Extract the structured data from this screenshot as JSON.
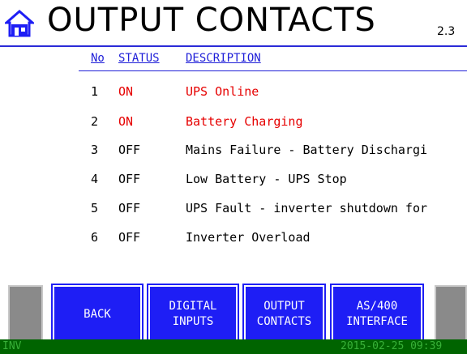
{
  "header": {
    "title": "OUTPUT CONTACTS",
    "version": "2.3",
    "home_icon": "home-icon"
  },
  "table": {
    "col_no": "No",
    "col_status": "STATUS",
    "col_description": "DESCRIPTION",
    "rows": [
      {
        "no": "1",
        "status": "ON",
        "description": "UPS Online"
      },
      {
        "no": "2",
        "status": "ON",
        "description": "Battery Charging"
      },
      {
        "no": "3",
        "status": "OFF",
        "description": "Mains Failure - Battery Dischargi"
      },
      {
        "no": "4",
        "status": "OFF",
        "description": "Low Battery - UPS Stop"
      },
      {
        "no": "5",
        "status": "OFF",
        "description": "UPS Fault - inverter shutdown for"
      },
      {
        "no": "6",
        "status": "OFF",
        "description": "Inverter Overload"
      }
    ]
  },
  "nav": {
    "back": "BACK",
    "digital_inputs_1": "DIGITAL",
    "digital_inputs_2": "INPUTS",
    "output_contacts_1": "OUTPUT",
    "output_contacts_2": "CONTACTS",
    "as400_1": "AS/400",
    "as400_2": "INTERFACE"
  },
  "status_bar": {
    "mode": "INV",
    "datetime": "2015-02-25 09:39"
  },
  "colors": {
    "accent_blue": "#1e1ef5",
    "on_red": "#e60000",
    "status_green": "#006400"
  }
}
